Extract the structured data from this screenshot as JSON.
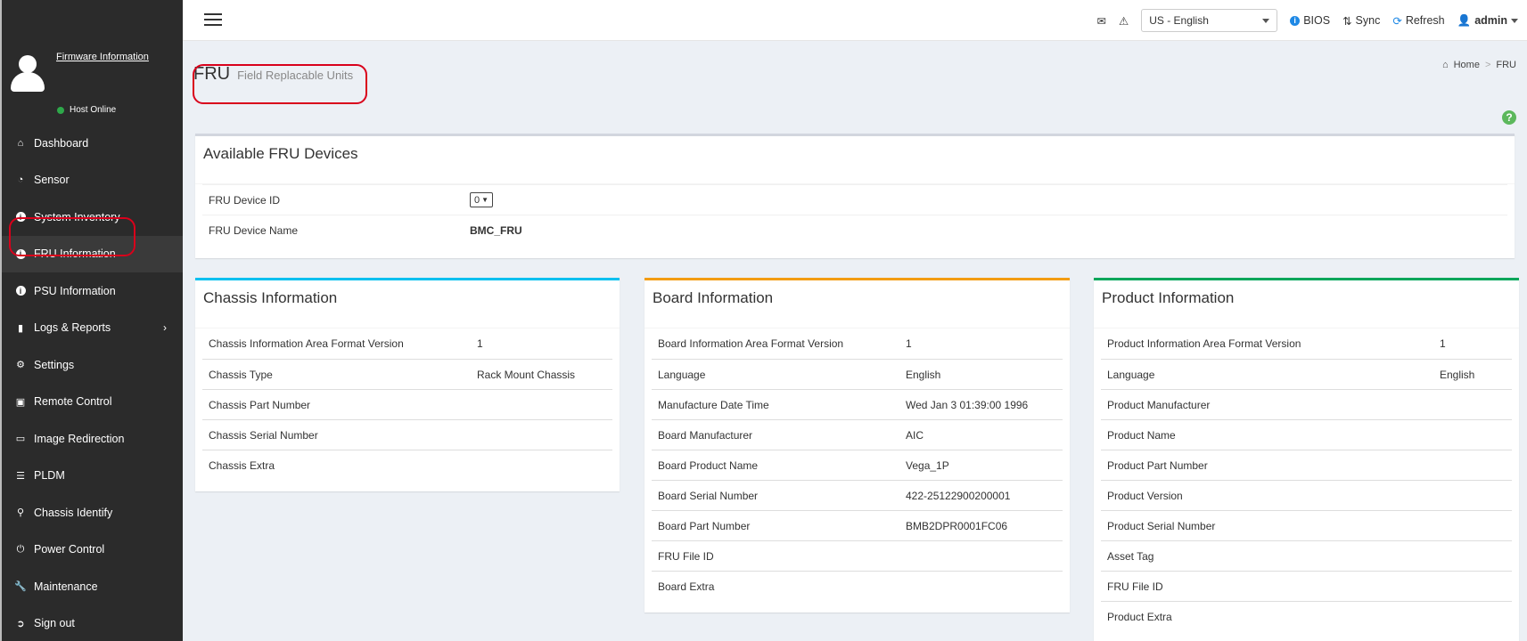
{
  "sidebar": {
    "firmware_link": "Firmware Information",
    "host_status": "Host Online",
    "status_color": "#2ea84a",
    "items": [
      {
        "label": "Dashboard",
        "icon": "home-icon"
      },
      {
        "label": "Sensor",
        "icon": "gauge-icon"
      },
      {
        "label": "System Inventory",
        "icon": "info-icon"
      },
      {
        "label": "FRU Information",
        "icon": "info-icon",
        "active": true
      },
      {
        "label": "PSU Information",
        "icon": "info-icon"
      },
      {
        "label": "Logs & Reports",
        "icon": "bar-chart-icon",
        "has_submenu": true
      },
      {
        "label": "Settings",
        "icon": "gear-icon"
      },
      {
        "label": "Remote Control",
        "icon": "monitor-icon"
      },
      {
        "label": "Image Redirection",
        "icon": "drive-icon"
      },
      {
        "label": "PLDM",
        "icon": "database-icon"
      },
      {
        "label": "Chassis Identify",
        "icon": "lightbulb-icon"
      },
      {
        "label": "Power Control",
        "icon": "power-icon"
      },
      {
        "label": "Maintenance",
        "icon": "wrench-icon"
      },
      {
        "label": "Sign out",
        "icon": "sign-out-icon"
      }
    ]
  },
  "topbar": {
    "language": "US - English",
    "bios_label": "BIOS",
    "sync_label": "Sync",
    "refresh_label": "Refresh",
    "user_label": "admin"
  },
  "page": {
    "title": "FRU",
    "subtitle": "Field Replacable Units",
    "breadcrumb_home": "Home",
    "breadcrumb_current": "FRU"
  },
  "available": {
    "title": "Available FRU Devices",
    "device_id_label": "FRU Device ID",
    "device_id_value": "0",
    "device_name_label": "FRU Device Name",
    "device_name_value": "BMC_FRU"
  },
  "chassis": {
    "title": "Chassis Information",
    "rows": [
      {
        "k": "Chassis Information Area Format Version",
        "v": "1"
      },
      {
        "k": "Chassis Type",
        "v": "Rack Mount Chassis"
      },
      {
        "k": "Chassis Part Number",
        "v": ""
      },
      {
        "k": "Chassis Serial Number",
        "v": ""
      },
      {
        "k": "Chassis Extra",
        "v": ""
      }
    ]
  },
  "board": {
    "title": "Board Information",
    "rows": [
      {
        "k": "Board Information Area Format Version",
        "v": "1"
      },
      {
        "k": "Language",
        "v": "English"
      },
      {
        "k": "Manufacture Date Time",
        "v": "Wed Jan 3 01:39:00 1996"
      },
      {
        "k": "Board Manufacturer",
        "v": "AIC"
      },
      {
        "k": "Board Product Name",
        "v": "Vega_1P"
      },
      {
        "k": "Board Serial Number",
        "v": "422-25122900200001"
      },
      {
        "k": "Board Part Number",
        "v": "BMB2DPR0001FC06"
      },
      {
        "k": "FRU File ID",
        "v": ""
      },
      {
        "k": "Board Extra",
        "v": ""
      }
    ]
  },
  "product": {
    "title": "Product Information",
    "rows": [
      {
        "k": "Product Information Area Format Version",
        "v": "1"
      },
      {
        "k": "Language",
        "v": "English"
      },
      {
        "k": "Product Manufacturer",
        "v": ""
      },
      {
        "k": "Product Name",
        "v": ""
      },
      {
        "k": "Product Part Number",
        "v": ""
      },
      {
        "k": "Product Version",
        "v": ""
      },
      {
        "k": "Product Serial Number",
        "v": ""
      },
      {
        "k": "Asset Tag",
        "v": ""
      },
      {
        "k": "FRU File ID",
        "v": ""
      },
      {
        "k": "Product Extra",
        "v": ""
      }
    ]
  },
  "colors": {
    "chassis_accent": "#00c0ef",
    "board_accent": "#f39c12",
    "product_accent": "#00a65a",
    "highlight": "#d9001b"
  }
}
